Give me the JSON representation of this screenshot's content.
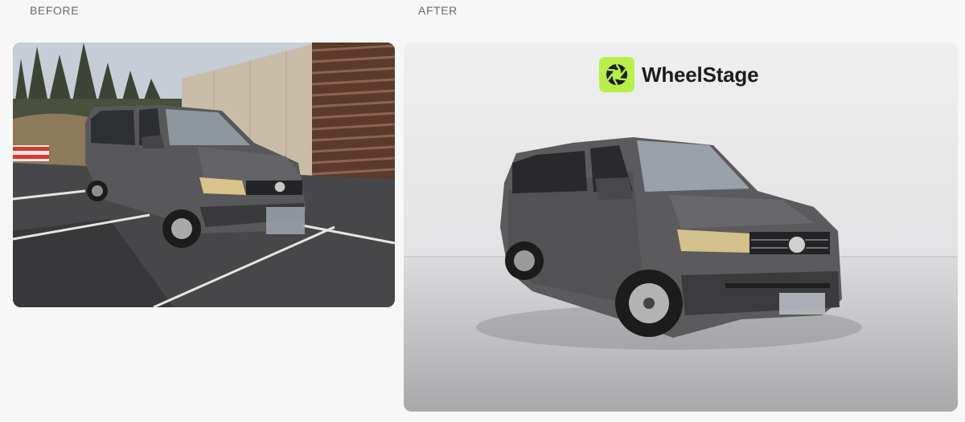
{
  "labels": {
    "before": "BEFORE",
    "after": "AFTER"
  },
  "after_photo": {
    "brand_name": "WheelStage",
    "brand_icon": "camera-aperture-icon",
    "brand_color": "#b8ef4a"
  },
  "colors": {
    "page_background": "#f7f7f7",
    "label_text": "#6a6a6a",
    "van_body": "#5b5b5d"
  }
}
